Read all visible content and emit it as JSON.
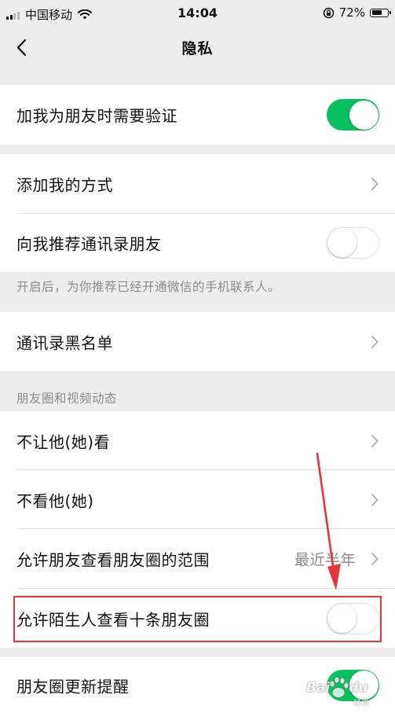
{
  "status_bar": {
    "carrier": "中国移动",
    "time": "14:04",
    "battery_percent": "72%",
    "battery_level": 0.72
  },
  "nav": {
    "title": "隐私"
  },
  "settings": {
    "verify_friend": {
      "label": "加我为朋友时需要验证",
      "enabled": true
    },
    "add_me_methods": {
      "label": "添加我的方式"
    },
    "recommend_contacts": {
      "label": "向我推荐通讯录朋友",
      "enabled": false
    },
    "recommend_note": "开启后，为你推荐已经开通微信的手机联系人。",
    "contacts_blacklist": {
      "label": "通讯录黑名单"
    },
    "moments_section_header": "朋友圈和视频动态",
    "hide_my_posts": {
      "label": "不让他(她)看"
    },
    "hide_their_posts": {
      "label": "不看他(她)"
    },
    "moments_visible_range": {
      "label": "允许朋友查看朋友圈的范围",
      "value": "最近半年"
    },
    "stranger_view_ten": {
      "label": "允许陌生人查看十条朋友圈",
      "enabled": false
    },
    "moments_update_reminder": {
      "label": "朋友圈更新提醒",
      "enabled": true
    }
  },
  "watermark": {
    "brand": "Bai",
    "brand_tail": "du",
    "sub": "经验"
  },
  "colors": {
    "accent_green": "#07c160",
    "annotation_red": "#e8343b",
    "background": "#ededed"
  }
}
